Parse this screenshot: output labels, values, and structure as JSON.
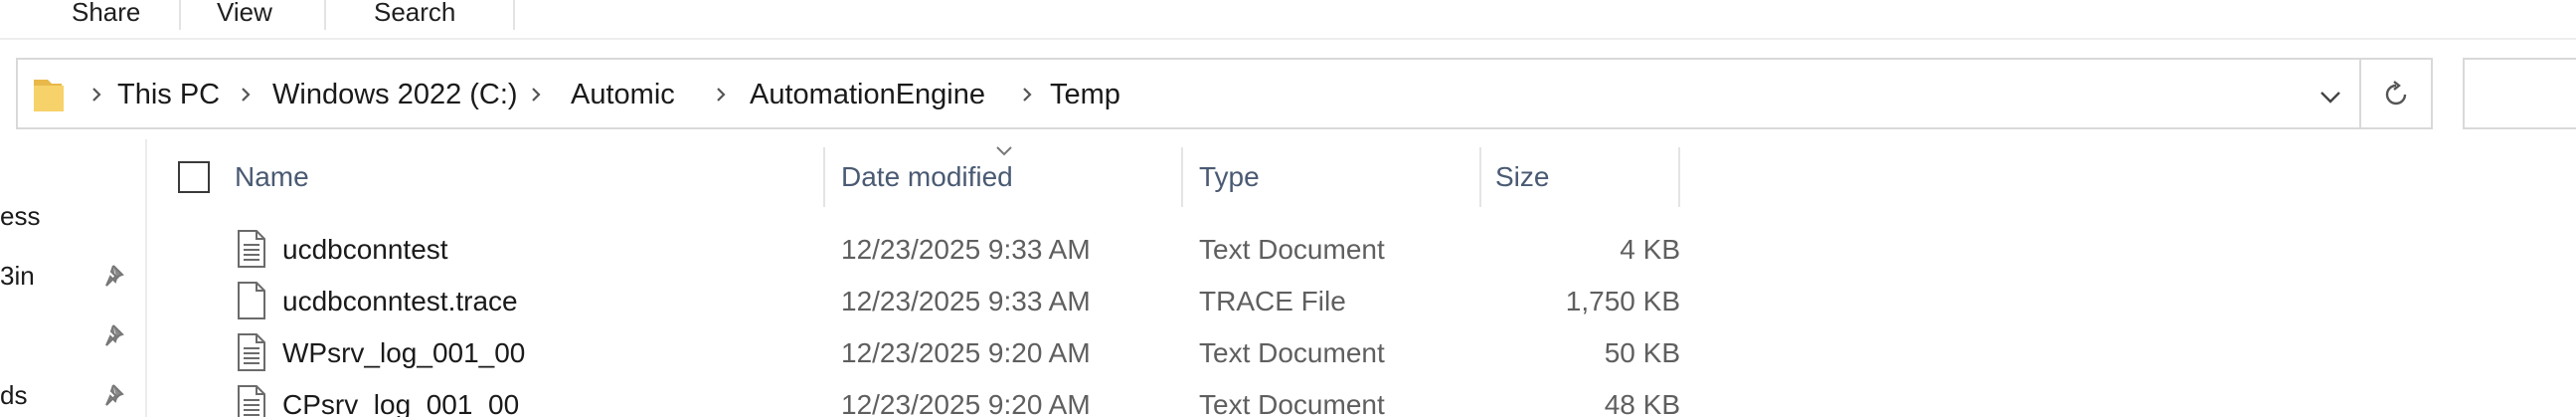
{
  "ribbon": {
    "tabs": [
      {
        "label": "Share"
      },
      {
        "label": "View"
      },
      {
        "label": "Search"
      }
    ]
  },
  "address_bar": {
    "breadcrumbs": [
      {
        "label": "This PC"
      },
      {
        "label": "Windows 2022 (C:)"
      },
      {
        "label": "Automic"
      },
      {
        "label": "AutomationEngine"
      },
      {
        "label": "Temp"
      }
    ]
  },
  "nav_pane": {
    "items": [
      {
        "label": "ess",
        "pinned": false
      },
      {
        "label": "3in",
        "pinned": true
      },
      {
        "label": "",
        "pinned": true
      },
      {
        "label": "ds",
        "pinned": true
      }
    ]
  },
  "columns": {
    "name": "Name",
    "date_modified": "Date modified",
    "type": "Type",
    "size": "Size"
  },
  "files": [
    {
      "name": "ucdbconntest",
      "date": "12/23/2025 9:33 AM",
      "type": "Text Document",
      "size": "4 KB",
      "icon": "text-document-icon"
    },
    {
      "name": "ucdbconntest.trace",
      "date": "12/23/2025 9:33 AM",
      "type": "TRACE File",
      "size": "1,750 KB",
      "icon": "blank-file-icon"
    },
    {
      "name": "WPsrv_log_001_00",
      "date": "12/23/2025 9:20 AM",
      "type": "Text Document",
      "size": "50 KB",
      "icon": "text-document-icon"
    },
    {
      "name": "CPsrv_log_001_00",
      "date": "12/23/2025 9:20 AM",
      "type": "Text Document",
      "size": "48 KB",
      "icon": "text-document-icon"
    }
  ]
}
